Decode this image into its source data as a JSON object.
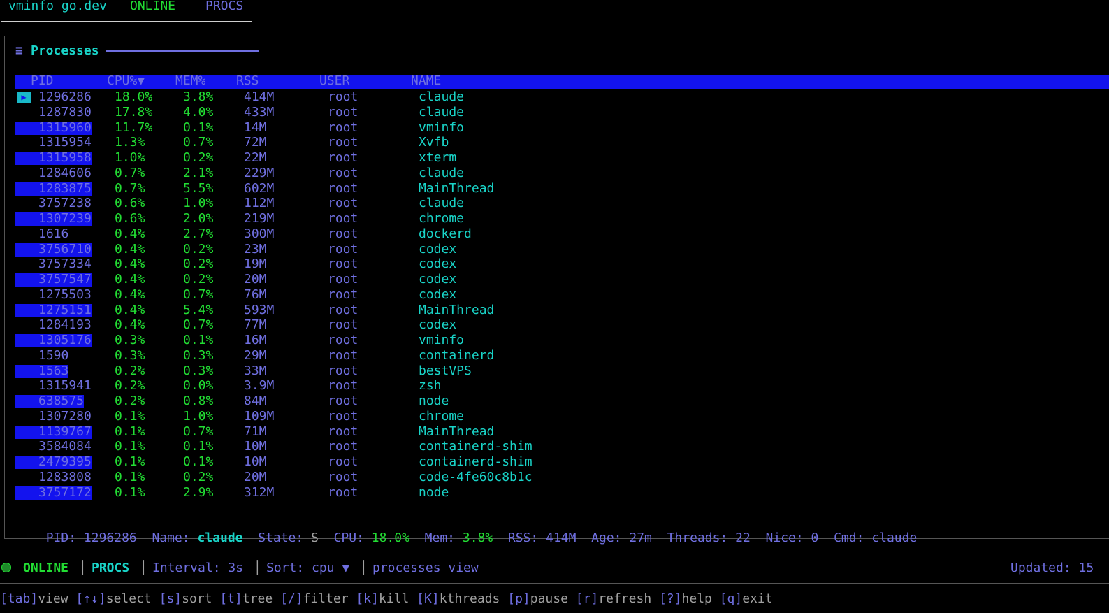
{
  "tabbar": {
    "title": "vminfo go.dev",
    "status": "ONLINE",
    "active_tab": "PROCS"
  },
  "panel": {
    "icon": "≡",
    "title": "Processes"
  },
  "table": {
    "columns": {
      "pid": "PID",
      "cpu": "CPU%▼",
      "mem": "MEM%",
      "rss": "RSS",
      "user": "USER",
      "name": "NAME"
    },
    "rows": [
      {
        "pid": "1296286",
        "cpu": "18.0%",
        "mem": "3.8%",
        "rss": "414M",
        "user": "root",
        "name": "claude",
        "selected": true
      },
      {
        "pid": "1287830",
        "cpu": "17.8%",
        "mem": "4.0%",
        "rss": "433M",
        "user": "root",
        "name": "claude"
      },
      {
        "pid": "1315960",
        "cpu": "11.7%",
        "mem": "0.1%",
        "rss": "14M",
        "user": "root",
        "name": "vminfo"
      },
      {
        "pid": "1315954",
        "cpu": "1.3%",
        "mem": "0.7%",
        "rss": "72M",
        "user": "root",
        "name": "Xvfb"
      },
      {
        "pid": "1315958",
        "cpu": "1.0%",
        "mem": "0.2%",
        "rss": "22M",
        "user": "root",
        "name": "xterm"
      },
      {
        "pid": "1284606",
        "cpu": "0.7%",
        "mem": "2.1%",
        "rss": "229M",
        "user": "root",
        "name": "claude"
      },
      {
        "pid": "1283875",
        "cpu": "0.7%",
        "mem": "5.5%",
        "rss": "602M",
        "user": "root",
        "name": "MainThread"
      },
      {
        "pid": "3757238",
        "cpu": "0.6%",
        "mem": "1.0%",
        "rss": "112M",
        "user": "root",
        "name": "claude"
      },
      {
        "pid": "1307239",
        "cpu": "0.6%",
        "mem": "2.0%",
        "rss": "219M",
        "user": "root",
        "name": "chrome"
      },
      {
        "pid": "1616",
        "cpu": "0.4%",
        "mem": "2.7%",
        "rss": "300M",
        "user": "root",
        "name": "dockerd"
      },
      {
        "pid": "3756710",
        "cpu": "0.4%",
        "mem": "0.2%",
        "rss": "23M",
        "user": "root",
        "name": "codex"
      },
      {
        "pid": "3757334",
        "cpu": "0.4%",
        "mem": "0.2%",
        "rss": "19M",
        "user": "root",
        "name": "codex"
      },
      {
        "pid": "3757547",
        "cpu": "0.4%",
        "mem": "0.2%",
        "rss": "20M",
        "user": "root",
        "name": "codex"
      },
      {
        "pid": "1275503",
        "cpu": "0.4%",
        "mem": "0.7%",
        "rss": "76M",
        "user": "root",
        "name": "codex"
      },
      {
        "pid": "1275151",
        "cpu": "0.4%",
        "mem": "5.4%",
        "rss": "593M",
        "user": "root",
        "name": "MainThread"
      },
      {
        "pid": "1284193",
        "cpu": "0.4%",
        "mem": "0.7%",
        "rss": "77M",
        "user": "root",
        "name": "codex"
      },
      {
        "pid": "1305176",
        "cpu": "0.3%",
        "mem": "0.1%",
        "rss": "16M",
        "user": "root",
        "name": "vminfo"
      },
      {
        "pid": "1590",
        "cpu": "0.3%",
        "mem": "0.3%",
        "rss": "29M",
        "user": "root",
        "name": "containerd"
      },
      {
        "pid": "1563",
        "cpu": "0.2%",
        "mem": "0.3%",
        "rss": "33M",
        "user": "root",
        "name": "bestVPS"
      },
      {
        "pid": "1315941",
        "cpu": "0.2%",
        "mem": "0.0%",
        "rss": "3.9M",
        "user": "root",
        "name": "zsh"
      },
      {
        "pid": "638575",
        "cpu": "0.2%",
        "mem": "0.8%",
        "rss": "84M",
        "user": "root",
        "name": "node"
      },
      {
        "pid": "1307280",
        "cpu": "0.1%",
        "mem": "1.0%",
        "rss": "109M",
        "user": "root",
        "name": "chrome"
      },
      {
        "pid": "1139767",
        "cpu": "0.1%",
        "mem": "0.7%",
        "rss": "71M",
        "user": "root",
        "name": "MainThread"
      },
      {
        "pid": "3584084",
        "cpu": "0.1%",
        "mem": "0.1%",
        "rss": "10M",
        "user": "root",
        "name": "containerd-shim"
      },
      {
        "pid": "2479395",
        "cpu": "0.1%",
        "mem": "0.1%",
        "rss": "10M",
        "user": "root",
        "name": "containerd-shim"
      },
      {
        "pid": "1283808",
        "cpu": "0.1%",
        "mem": "0.2%",
        "rss": "20M",
        "user": "root",
        "name": "code-4fe60c8b1c"
      },
      {
        "pid": "3757172",
        "cpu": "0.1%",
        "mem": "2.9%",
        "rss": "312M",
        "user": "root",
        "name": "node"
      }
    ]
  },
  "detail": {
    "pid_label": "PID:",
    "pid": "1296286",
    "name_label": "Name:",
    "name": "claude",
    "state_label": "State:",
    "state": "S",
    "cpu_label": "CPU:",
    "cpu": "18.0%",
    "mem_label": "Mem:",
    "mem": "3.8%",
    "rss_label": "RSS:",
    "rss": "414M",
    "age_label": "Age:",
    "age": "27m",
    "threads_label": "Threads:",
    "threads": "22",
    "nice_label": "Nice:",
    "nice": "0",
    "cmd_label": "Cmd:",
    "cmd": "claude"
  },
  "statusbar": {
    "status": "ONLINE",
    "tab": "PROCS",
    "interval": "Interval: 3s",
    "sort": "Sort: cpu ▼",
    "view": "processes view",
    "updated": "Updated: 15"
  },
  "keybar": [
    {
      "key": "[tab]",
      "label": "view"
    },
    {
      "key": "[↑↓]",
      "label": "select"
    },
    {
      "key": "[s]",
      "label": "sort"
    },
    {
      "key": "[t]",
      "label": "tree"
    },
    {
      "key": "[/]",
      "label": "filter"
    },
    {
      "key": "[k]",
      "label": "kill"
    },
    {
      "key": "[K]",
      "label": "kthreads"
    },
    {
      "key": "[p]",
      "label": "pause"
    },
    {
      "key": "[r]",
      "label": "refresh"
    },
    {
      "key": "[?]",
      "label": "help"
    },
    {
      "key": "[q]",
      "label": "exit"
    }
  ],
  "colors": {
    "accent": "#6f6fe0",
    "cyan": "#19d4c8",
    "green": "#22dd33",
    "highlight": "#1313ee"
  }
}
